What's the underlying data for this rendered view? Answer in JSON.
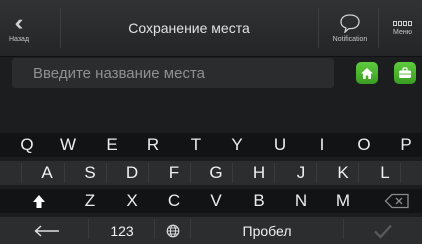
{
  "header": {
    "back_label": "Назад",
    "title": "Сохранение места",
    "notification_label": "Notification",
    "menu_label": "Меню"
  },
  "search": {
    "value": "",
    "placeholder": "Введите название места"
  },
  "keyboard": {
    "row1": [
      "Q",
      "W",
      "E",
      "R",
      "T",
      "Y",
      "U",
      "I",
      "O",
      "P"
    ],
    "row2": [
      "A",
      "S",
      "D",
      "F",
      "G",
      "H",
      "J",
      "K",
      "L"
    ],
    "row3": [
      "Z",
      "X",
      "C",
      "V",
      "B",
      "N",
      "M"
    ],
    "numbers_label": "123",
    "space_label": "Пробел"
  },
  "colors": {
    "accent_green": "#4cb62d",
    "background": "#1c1d1f"
  }
}
